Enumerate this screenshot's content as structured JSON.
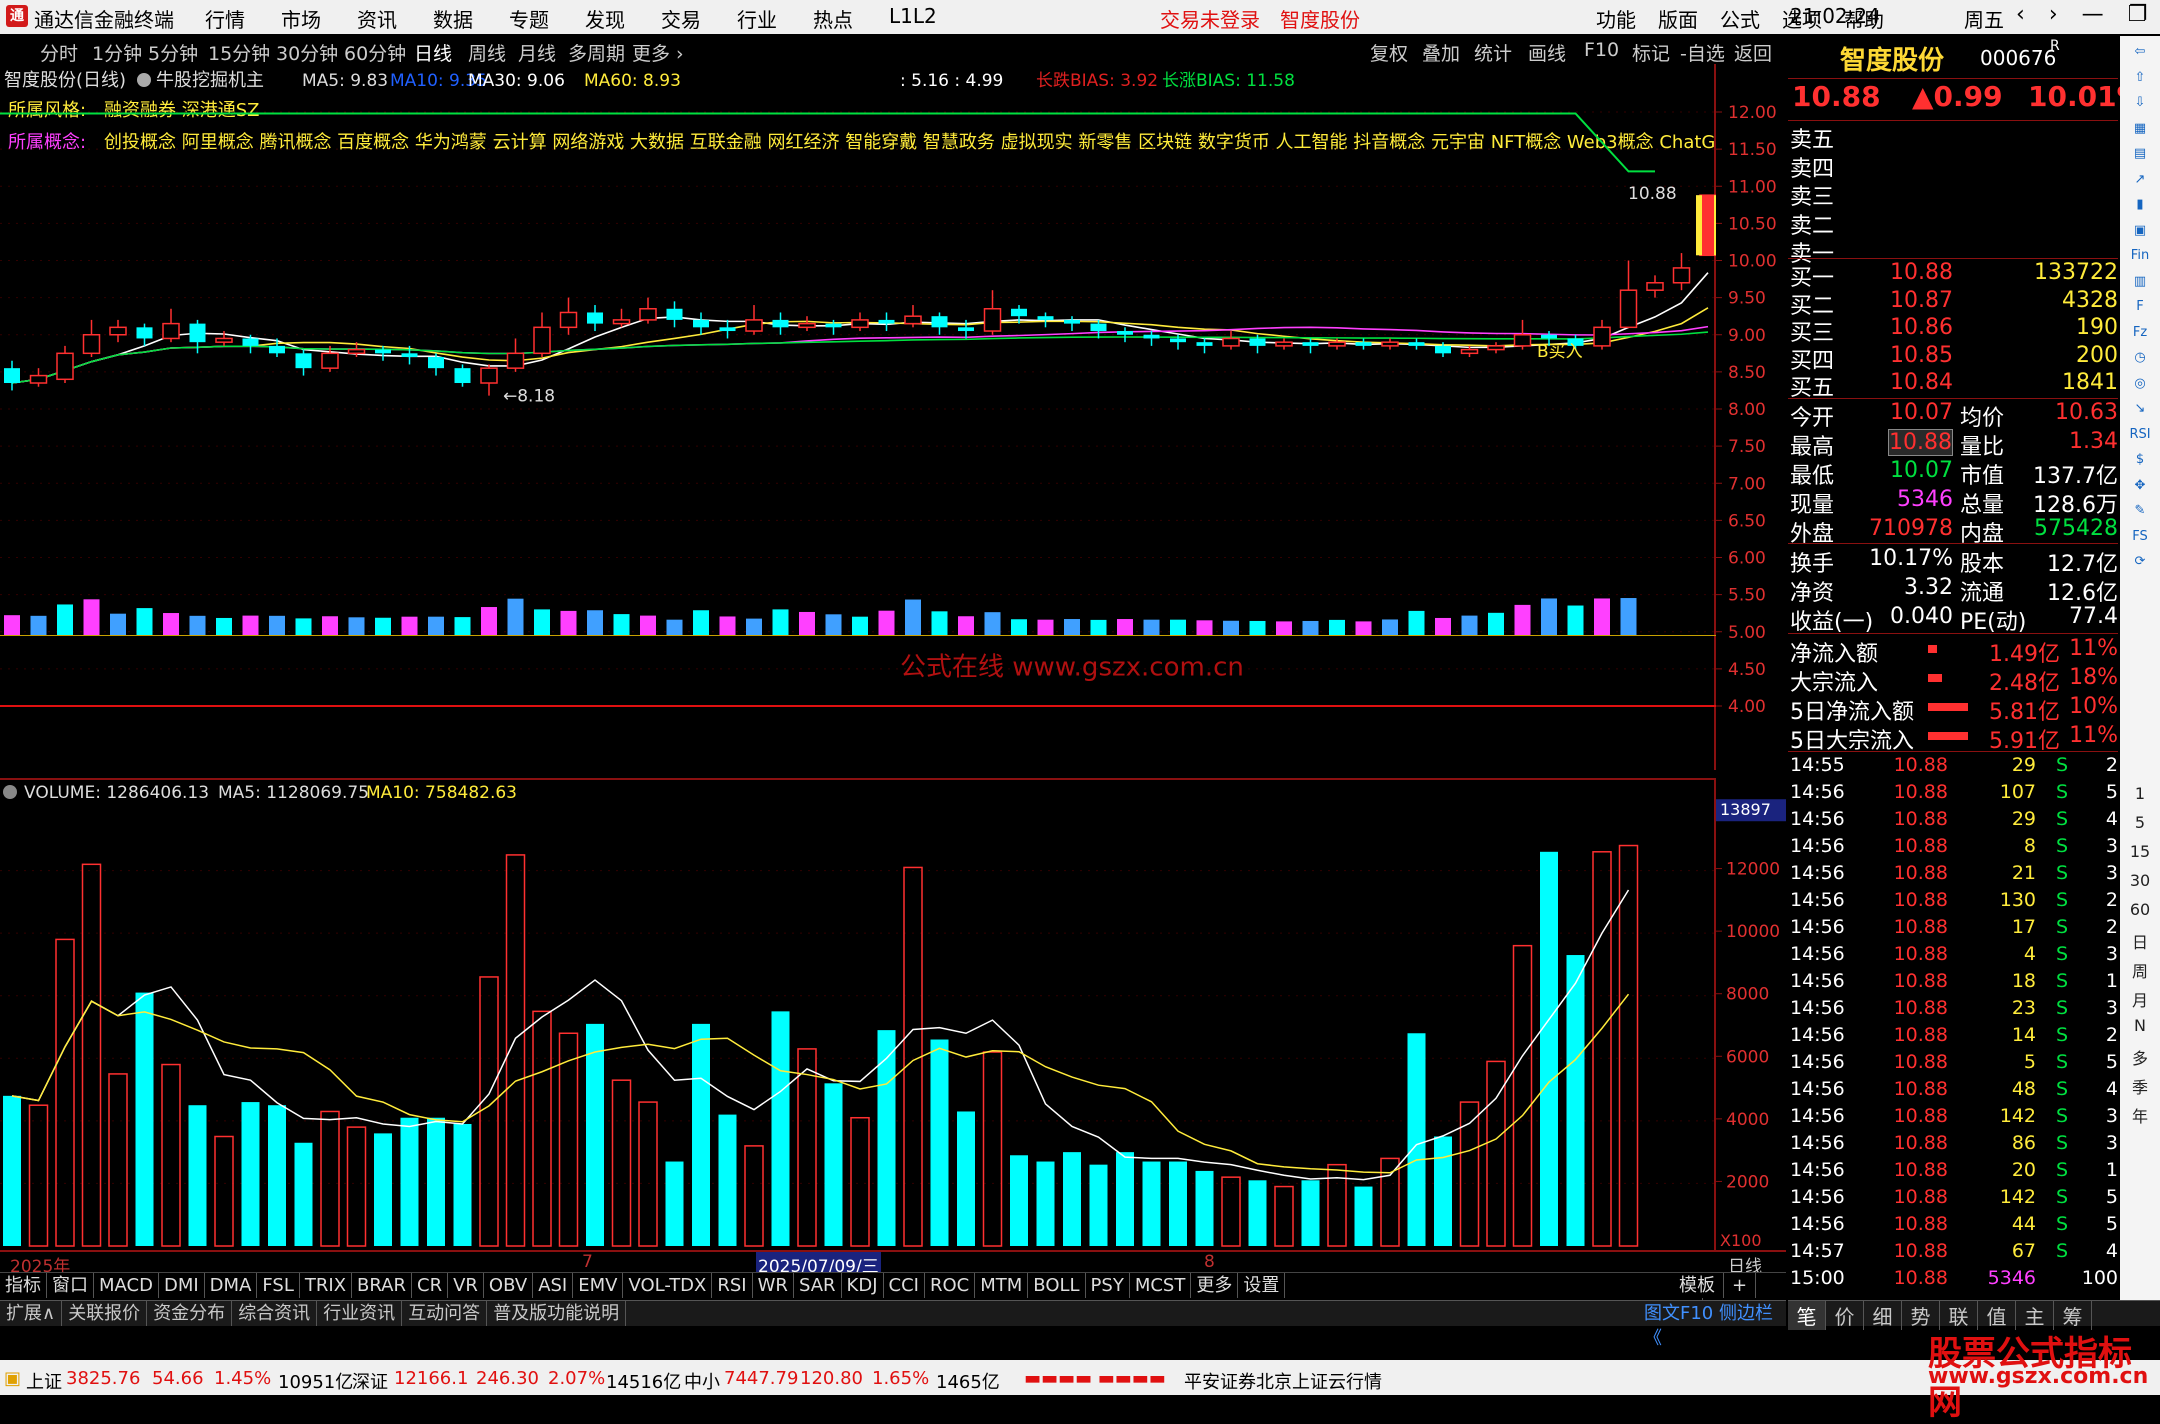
{
  "app": {
    "name": "通达信金融终端",
    "menus": [
      "行情",
      "市场",
      "资讯",
      "数据",
      "专题",
      "发现",
      "交易",
      "行业",
      "热点",
      "L1L2"
    ],
    "trade_status": "交易未登录",
    "stock_name_title": "智度股份",
    "right_menus": [
      "功能",
      "版面",
      "公式",
      "选项",
      "帮助"
    ],
    "time": "21:02:24",
    "weekday": "周五",
    "win_buttons": [
      "‹",
      "›",
      "—",
      "❐",
      "✕"
    ]
  },
  "periods": {
    "items": [
      "分时",
      "1分钟",
      "5分钟",
      "15分钟",
      "30分钟",
      "60分钟",
      "日线",
      "周线",
      "月线",
      "多周期",
      "更多 ›"
    ],
    "active": "日线"
  },
  "toolbar": {
    "items": [
      "复权",
      "叠加",
      "统计",
      "画线",
      "F10",
      "标记",
      "-自选",
      "返回"
    ]
  },
  "chart_header": {
    "stock": "智度股份(日线)",
    "indicator": "牛股挖掘机主",
    "ma5": "MA5: 9.83",
    "ma10": "MA10: 9.35",
    "ma30": "MA30: 9.06",
    "ma60": "MA60: 8.93",
    "ratio": ": 5.16 : 4.99",
    "bias_long": "长跌BIAS: 3.92",
    "bias_up": "长涨BIAS: 11.58"
  },
  "style_line": {
    "label": "所属风格:",
    "value": "融资融券 深港通SZ"
  },
  "concept_line": {
    "label": "所属概念:",
    "value": "创投概念 阿里概念 腾讯概念 百度概念 华为鸿蒙 云计算 网络游戏 大数据 互联金融 网红经济 智能穿戴 智慧政务 虚拟现实 新零售 区块链 数字货币 人工智能 抖音概念 元宇宙 NFT概念 Web3概念 ChatGPT"
  },
  "price_annotations": {
    "high": "10.88",
    "low": "8.18",
    "buy": "B买入"
  },
  "main_yaxis": [
    "12.00",
    "11.50",
    "11.00",
    "10.50",
    "10.00",
    "9.50",
    "9.00",
    "8.50",
    "8.00",
    "7.50",
    "7.00",
    "6.50",
    "6.00",
    "5.50",
    "5.00",
    "4.50",
    "4.00"
  ],
  "watermark_center": "公式在线  www.gszx.com.cn",
  "volume_header": {
    "label": "VOLUME: 1286406.13",
    "ma5": "MA5: 1128069.75",
    "ma10": "MA10: 758482.63"
  },
  "vol_yaxis": [
    "12000",
    "10000",
    "8000",
    "6000",
    "4000",
    "2000"
  ],
  "vol_cursor": "13897",
  "vol_unit": "X100",
  "date_axis": {
    "year": "2025年",
    "m7": "7",
    "cursor_date": "2025/07/09/三",
    "m8": "8",
    "period": "日线"
  },
  "indicator_tabs": [
    "指标",
    "窗口",
    "MACD",
    "DMI",
    "DMA",
    "FSL",
    "TRIX",
    "BRAR",
    "CR",
    "VR",
    "OBV",
    "ASI",
    "EMV",
    "VOL-TDX",
    "RSI",
    "WR",
    "SAR",
    "KDJ",
    "CCI",
    "ROC",
    "MTM",
    "BOLL",
    "PSY",
    "MCST",
    "更多",
    "设置"
  ],
  "template_tabs": [
    "模板",
    "+",
    "−"
  ],
  "bottom_tabs": [
    "扩展∧",
    "关联报价",
    "资金分布",
    "综合资讯",
    "行业资讯",
    "互动问答",
    "普及版功能说明"
  ],
  "bottom_right_link": "图文F10 侧边栏《",
  "quote": {
    "name": "智度股份",
    "code": "000676",
    "code_suffix": "R",
    "price": "10.88",
    "change": "▲0.99",
    "pct": "10.01%",
    "asks": [
      {
        "label": "卖五"
      },
      {
        "label": "卖四"
      },
      {
        "label": "卖三"
      },
      {
        "label": "卖二"
      },
      {
        "label": "卖一"
      }
    ],
    "bids": [
      {
        "label": "买一",
        "price": "10.88",
        "vol": "133722"
      },
      {
        "label": "买二",
        "price": "10.87",
        "vol": "4328"
      },
      {
        "label": "买三",
        "price": "10.86",
        "vol": "190"
      },
      {
        "label": "买四",
        "price": "10.85",
        "vol": "200"
      },
      {
        "label": "买五",
        "price": "10.84",
        "vol": "1841"
      }
    ],
    "stats": [
      {
        "l1": "今开",
        "v1": "10.07",
        "l2": "均价",
        "v2": "10.63"
      },
      {
        "l1": "最高",
        "v1": "10.88",
        "l2": "量比",
        "v2": "1.34"
      },
      {
        "l1": "最低",
        "v1": "10.07",
        "l2": "市值",
        "v2": "137.7亿"
      },
      {
        "l1": "现量",
        "v1": "5346",
        "l2": "总量",
        "v2": "128.6万"
      },
      {
        "l1": "外盘",
        "v1": "710978",
        "l2": "内盘",
        "v2": "575428"
      }
    ],
    "stats2": [
      {
        "l1": "换手",
        "v1": "10.17%",
        "l2": "股本",
        "v2": "12.7亿"
      },
      {
        "l1": "净资",
        "v1": "3.32",
        "l2": "流通",
        "v2": "12.6亿"
      },
      {
        "l1": "收益(一)",
        "v1": "0.040",
        "l2": "PE(动)",
        "v2": "77.4"
      }
    ],
    "flows": [
      {
        "label": "净流入额",
        "value": "1.49亿",
        "pct": "11%",
        "bar": 0.11
      },
      {
        "label": "大宗流入",
        "value": "2.48亿",
        "pct": "18%",
        "bar": 0.18
      },
      {
        "label": "5日净流入额",
        "value": "5.81亿",
        "pct": "10%",
        "bar": 0.5
      },
      {
        "label": "5日大宗流入",
        "value": "5.91亿",
        "pct": "11%",
        "bar": 0.5
      }
    ],
    "ticks": [
      {
        "t": "14:55",
        "p": "10.88",
        "v": "29",
        "s": "S",
        "n": "2"
      },
      {
        "t": "14:56",
        "p": "10.88",
        "v": "107",
        "s": "S",
        "n": "5"
      },
      {
        "t": "14:56",
        "p": "10.88",
        "v": "29",
        "s": "S",
        "n": "4"
      },
      {
        "t": "14:56",
        "p": "10.88",
        "v": "8",
        "s": "S",
        "n": "3"
      },
      {
        "t": "14:56",
        "p": "10.88",
        "v": "21",
        "s": "S",
        "n": "3"
      },
      {
        "t": "14:56",
        "p": "10.88",
        "v": "130",
        "s": "S",
        "n": "2"
      },
      {
        "t": "14:56",
        "p": "10.88",
        "v": "17",
        "s": "S",
        "n": "2"
      },
      {
        "t": "14:56",
        "p": "10.88",
        "v": "4",
        "s": "S",
        "n": "3"
      },
      {
        "t": "14:56",
        "p": "10.88",
        "v": "18",
        "s": "S",
        "n": "1"
      },
      {
        "t": "14:56",
        "p": "10.88",
        "v": "23",
        "s": "S",
        "n": "3"
      },
      {
        "t": "14:56",
        "p": "10.88",
        "v": "14",
        "s": "S",
        "n": "2"
      },
      {
        "t": "14:56",
        "p": "10.88",
        "v": "5",
        "s": "S",
        "n": "5"
      },
      {
        "t": "14:56",
        "p": "10.88",
        "v": "48",
        "s": "S",
        "n": "4"
      },
      {
        "t": "14:56",
        "p": "10.88",
        "v": "142",
        "s": "S",
        "n": "3"
      },
      {
        "t": "14:56",
        "p": "10.88",
        "v": "86",
        "s": "S",
        "n": "3"
      },
      {
        "t": "14:56",
        "p": "10.88",
        "v": "20",
        "s": "S",
        "n": "1"
      },
      {
        "t": "14:56",
        "p": "10.88",
        "v": "142",
        "s": "S",
        "n": "5"
      },
      {
        "t": "14:56",
        "p": "10.88",
        "v": "44",
        "s": "S",
        "n": "5"
      },
      {
        "t": "14:57",
        "p": "10.88",
        "v": "67",
        "s": "S",
        "n": "4"
      },
      {
        "t": "15:00",
        "p": "10.88",
        "v": "5346",
        "s": "",
        "n": "100"
      }
    ]
  },
  "right_bottom_tabs": [
    "笔",
    "价",
    "细",
    "势",
    "联",
    "值",
    "主",
    "筹"
  ],
  "sidebar_labels": [
    "1",
    "5",
    "15",
    "30",
    "60",
    "日",
    "周",
    "月",
    "N",
    "多",
    "季",
    "年"
  ],
  "statusbar": {
    "sh": {
      "name": "上证",
      "val": "3825.76",
      "chg": "54.66",
      "pct": "1.45%",
      "amt": "10951亿"
    },
    "sz": {
      "name": "深证",
      "val": "12166.1",
      "chg": "246.30",
      "pct": "2.07%",
      "amt": "14516亿"
    },
    "zx": {
      "name": "中小",
      "val": "7447.79",
      "chg": "120.80",
      "pct": "1.65%",
      "amt": "1465亿"
    },
    "broker": "平安证券北京上证云行情"
  },
  "watermark": {
    "line1": "股票公式指标网",
    "line2": "www.gszx.com.cn"
  },
  "colors": {
    "up": "#ff3030",
    "down": "#00ffff",
    "ma5": "#ffffff",
    "ma10": "#ffeb3b",
    "ma30": "#ff40ff",
    "ma60": "#00e040"
  },
  "chart_data": {
    "type": "candlestick",
    "candles": [
      [
        8.55,
        8.35,
        8.65,
        8.25
      ],
      [
        8.35,
        8.45,
        8.55,
        8.3
      ],
      [
        8.4,
        8.75,
        8.85,
        8.35
      ],
      [
        8.75,
        9.0,
        9.2,
        8.7
      ],
      [
        9.0,
        9.1,
        9.2,
        8.9
      ],
      [
        9.1,
        8.95,
        9.15,
        8.85
      ],
      [
        8.95,
        9.15,
        9.35,
        8.9
      ],
      [
        9.15,
        8.9,
        9.2,
        8.75
      ],
      [
        8.9,
        8.95,
        9.05,
        8.85
      ],
      [
        8.95,
        8.85,
        9.0,
        8.75
      ],
      [
        8.85,
        8.75,
        8.95,
        8.7
      ],
      [
        8.75,
        8.55,
        8.8,
        8.45
      ],
      [
        8.55,
        8.75,
        8.85,
        8.5
      ],
      [
        8.75,
        8.8,
        8.9,
        8.7
      ],
      [
        8.8,
        8.75,
        8.85,
        8.65
      ],
      [
        8.75,
        8.7,
        8.85,
        8.6
      ],
      [
        8.7,
        8.55,
        8.75,
        8.45
      ],
      [
        8.55,
        8.35,
        8.6,
        8.3
      ],
      [
        8.35,
        8.55,
        8.6,
        8.18
      ],
      [
        8.55,
        8.75,
        8.95,
        8.5
      ],
      [
        8.75,
        9.1,
        9.3,
        8.7
      ],
      [
        9.1,
        9.3,
        9.5,
        9.0
      ],
      [
        9.3,
        9.15,
        9.4,
        9.05
      ],
      [
        9.15,
        9.2,
        9.35,
        9.1
      ],
      [
        9.2,
        9.35,
        9.5,
        9.15
      ],
      [
        9.35,
        9.2,
        9.45,
        9.1
      ],
      [
        9.2,
        9.1,
        9.3,
        9.0
      ],
      [
        9.1,
        9.05,
        9.2,
        8.95
      ],
      [
        9.05,
        9.2,
        9.4,
        9.0
      ],
      [
        9.2,
        9.1,
        9.3,
        9.0
      ],
      [
        9.1,
        9.15,
        9.25,
        9.05
      ],
      [
        9.15,
        9.1,
        9.2,
        9.0
      ],
      [
        9.1,
        9.2,
        9.3,
        9.05
      ],
      [
        9.2,
        9.15,
        9.3,
        9.05
      ],
      [
        9.15,
        9.25,
        9.4,
        9.1
      ],
      [
        9.25,
        9.1,
        9.3,
        9.0
      ],
      [
        9.1,
        9.05,
        9.2,
        8.95
      ],
      [
        9.05,
        9.35,
        9.6,
        9.0
      ],
      [
        9.35,
        9.25,
        9.4,
        9.15
      ],
      [
        9.25,
        9.2,
        9.3,
        9.1
      ],
      [
        9.2,
        9.15,
        9.25,
        9.05
      ],
      [
        9.15,
        9.05,
        9.2,
        8.95
      ],
      [
        9.05,
        9.0,
        9.1,
        8.9
      ],
      [
        9.0,
        8.95,
        9.05,
        8.85
      ],
      [
        8.95,
        8.9,
        9.0,
        8.8
      ],
      [
        8.9,
        8.85,
        8.95,
        8.75
      ],
      [
        8.85,
        8.95,
        9.05,
        8.8
      ],
      [
        8.95,
        8.85,
        9.0,
        8.75
      ],
      [
        8.85,
        8.9,
        8.95,
        8.8
      ],
      [
        8.9,
        8.85,
        8.95,
        8.75
      ],
      [
        8.85,
        8.9,
        8.95,
        8.8
      ],
      [
        8.9,
        8.85,
        8.95,
        8.8
      ],
      [
        8.85,
        8.9,
        8.95,
        8.8
      ],
      [
        8.9,
        8.85,
        8.95,
        8.8
      ],
      [
        8.85,
        8.75,
        8.9,
        8.7
      ],
      [
        8.75,
        8.8,
        8.85,
        8.7
      ],
      [
        8.8,
        8.85,
        8.9,
        8.75
      ],
      [
        8.85,
        9.0,
        9.2,
        8.8
      ],
      [
        9.0,
        8.95,
        9.05,
        8.85
      ],
      [
        8.95,
        8.85,
        9.0,
        8.8
      ],
      [
        8.85,
        9.1,
        9.2,
        8.8
      ],
      [
        9.1,
        9.6,
        10.0,
        9.1
      ],
      [
        9.6,
        9.7,
        9.8,
        9.5
      ],
      [
        9.7,
        9.9,
        10.1,
        9.6
      ],
      [
        10.07,
        10.88,
        10.88,
        10.07
      ]
    ],
    "volume": [
      4800,
      4500,
      9800,
      12200,
      5500,
      8100,
      5800,
      4500,
      3500,
      4600,
      4500,
      3300,
      4300,
      3800,
      3600,
      4100,
      4100,
      3900,
      8600,
      12500,
      7500,
      6800,
      7100,
      5300,
      4600,
      2700,
      7100,
      4200,
      3200,
      7500,
      6300,
      5200,
      4100,
      6900,
      12100,
      6600,
      4300,
      6200,
      2900,
      2700,
      3000,
      2600,
      3000,
      2700,
      2700,
      2400,
      2200,
      2100,
      1900,
      2100,
      2600,
      1900,
      2800,
      6800,
      3500,
      4600,
      5900,
      9600,
      12600,
      9300,
      12600,
      12800
    ],
    "y_range": [
      4.0,
      12.0
    ],
    "vol_range": [
      0,
      14000
    ]
  }
}
